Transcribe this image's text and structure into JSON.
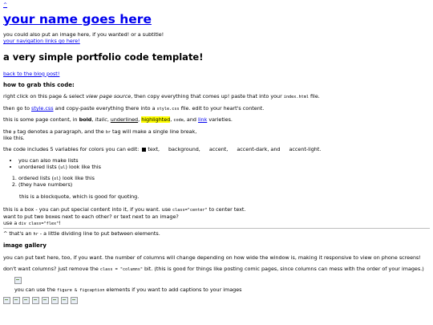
{
  "top_link": "^",
  "header": {
    "title": "your name goes here",
    "subtitle": "you could also put an image here, if you wanted! or a subtitle!",
    "nav_link": "your navigation links go here!"
  },
  "post": {
    "title": "a very simple portfolio code template!",
    "back_link": "back to the blog post!",
    "grab_heading": "how to grab this code:",
    "grab_p1": {
      "pre": "right click on this page & select ",
      "em": "view page source",
      "mid": ", then copy everything that comes up! paste that into your ",
      "code": "index.html",
      "post": " file."
    },
    "grab_p2": {
      "pre": "then go to ",
      "link": "style.css",
      "mid": " and copy-paste everything there into a ",
      "code": "style.css",
      "post": " file. edit to your heart's content."
    },
    "content_p": {
      "pre": "this is some page content, in ",
      "bold": "bold",
      "sep1": ", ",
      "italic": "italic",
      "sep2": ", ",
      "underlined": "underlined",
      "sep3": ", ",
      "highlighted": "highlighted",
      "sep4": ", ",
      "code": "code",
      "sep5": ", and ",
      "link": "link",
      "post": " varieties."
    },
    "tags_p": {
      "pre": "the ",
      "p_code": "p",
      "mid1": " tag denotes a paragraph, and the ",
      "br_code": "br",
      "mid2": " tag will make a single line break,",
      "line2": "like this."
    },
    "colors_p": {
      "pre": "the code includes 5 variables for colors you can edit:",
      "c1": "text,",
      "c2": "background,",
      "c3": "accent,",
      "c4": "accent-dark, and",
      "c5": "accent-light."
    },
    "colors": {
      "text": "#000000",
      "background": "#ffffff",
      "accent": "#ffffff",
      "accent_dark": "#ffffff",
      "accent_light": "#ffffff"
    },
    "ul_items": [
      {
        "pre": "you can also make lists",
        "code": "",
        "post": ""
      },
      {
        "pre": "unordered lists (",
        "code": "ul",
        "post": ") look like this"
      }
    ],
    "ol_items": [
      {
        "pre": "ordered lists (",
        "code": "ol",
        "post": ") look like this"
      },
      {
        "pre": "(they have numbers)",
        "code": "",
        "post": ""
      }
    ],
    "blockquote": "this is a blockquote, which is good for quoting.",
    "box": {
      "l1_pre": "this is a box - you can put special content into it, if you want. use ",
      "l1_code": "class=\"center\"",
      "l1_post": " to center text.",
      "l2": "want to put two boxes next to each other? or text next to an image?",
      "l3_pre": "use a ",
      "l3_code": "div class=\"flex\"",
      "l3_post": "!"
    },
    "hr_note": {
      "pre": "^ that's an ",
      "code": "hr",
      "post": " - a little dividing line to put between elements."
    },
    "gallery_heading": "image gallery",
    "gallery_p1": "you can put text here, too, if you want. the number of columns will change depending on how wide the window is, making it responsive to view on phone screens!",
    "gallery_p2": {
      "pre": "don't want columns? just remove the ",
      "code": "class = \"columns\"",
      "post": " bit. (this is good for things like posting comic pages, since columns can mess with the order of your images.)"
    },
    "figcaption": {
      "pre": "you can use the ",
      "code": "figure & figcaption",
      "post": " elements if you want to add captions to your images"
    }
  }
}
